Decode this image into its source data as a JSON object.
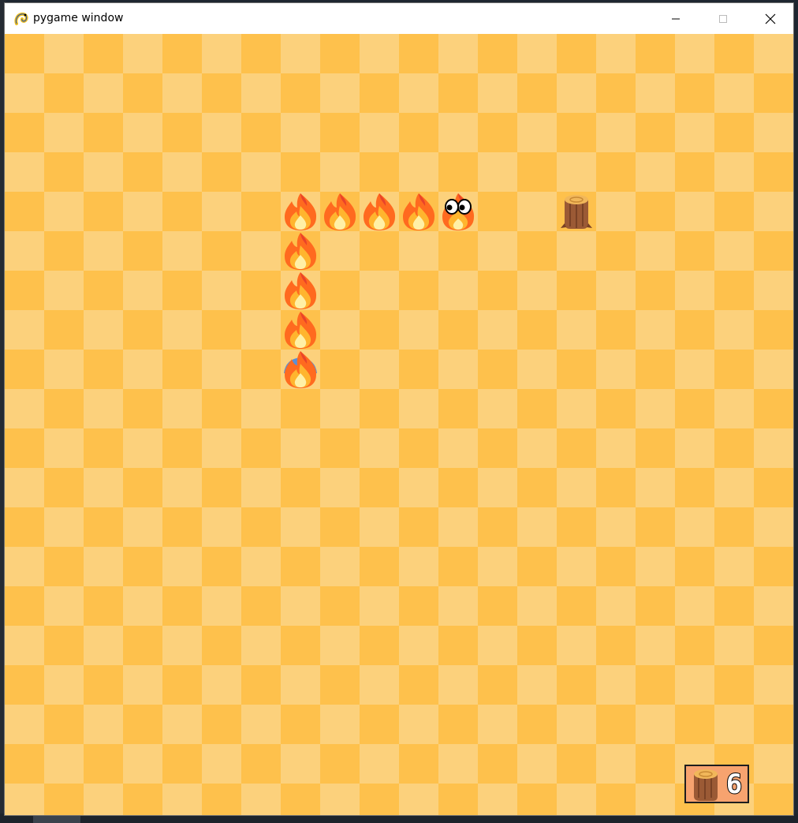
{
  "window": {
    "title": "pygame window",
    "controls": {
      "minimize": "minimize",
      "maximize": "maximize",
      "close": "close"
    }
  },
  "icons": {
    "app": "pygame-snake-icon",
    "minimize": "minimize-icon",
    "maximize": "maximize-icon",
    "close": "close-icon",
    "snake_body": "fire-icon",
    "snake_head": "fire-with-eyes-icon",
    "snake_tail": "fire-blue-tail-icon",
    "food": "log-stump-icon"
  },
  "colors": {
    "board_light": "#fcd17c",
    "board_dark": "#fec14c",
    "score_bg": "#f7a36f"
  },
  "game": {
    "grid": {
      "columns": 20,
      "rows": 20
    },
    "score": "6",
    "snake": [
      {
        "col": 11,
        "row": 4,
        "part": "head"
      },
      {
        "col": 10,
        "row": 4,
        "part": "body"
      },
      {
        "col": 9,
        "row": 4,
        "part": "body"
      },
      {
        "col": 8,
        "row": 4,
        "part": "body"
      },
      {
        "col": 7,
        "row": 4,
        "part": "body"
      },
      {
        "col": 7,
        "row": 5,
        "part": "body"
      },
      {
        "col": 7,
        "row": 6,
        "part": "body"
      },
      {
        "col": 7,
        "row": 7,
        "part": "body"
      },
      {
        "col": 7,
        "row": 8,
        "part": "tail"
      }
    ],
    "food": {
      "col": 14,
      "row": 4
    }
  }
}
